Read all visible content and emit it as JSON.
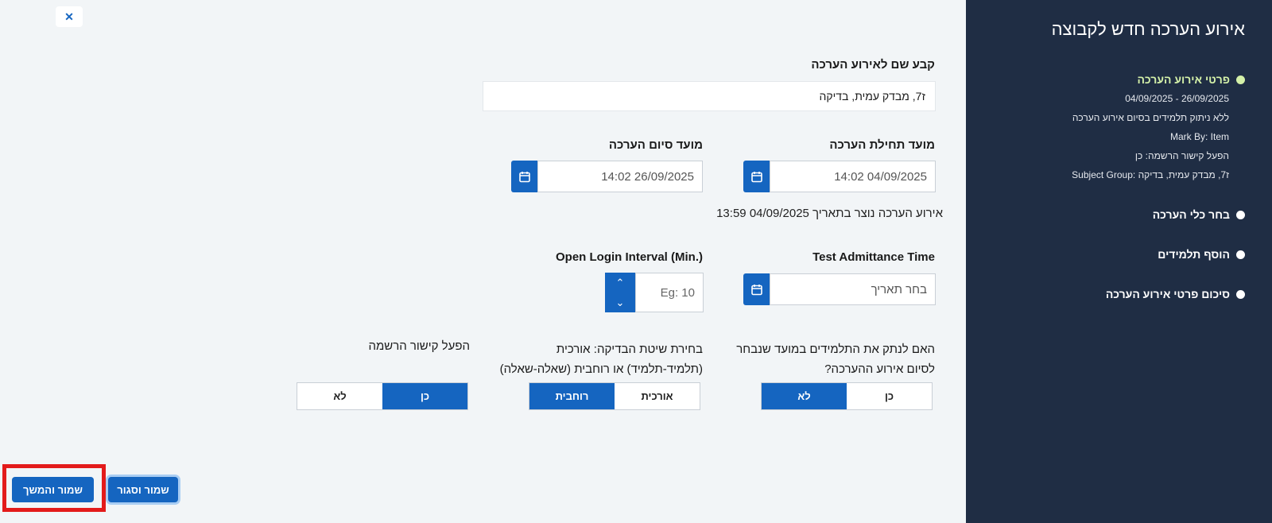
{
  "sidebar": {
    "title": "אירוע הערכה חדש לקבוצה",
    "steps": [
      {
        "label": "פרטי אירוע הערכה"
      },
      {
        "label": "בחר כלי הערכה"
      },
      {
        "label": "הוסף תלמידים"
      },
      {
        "label": "סיכום פרטי אירוע הערכה"
      }
    ],
    "details": [
      "26/09/2025 - 04/09/2025",
      "ללא ניתוק תלמידים בסיום אירוע הערכה",
      "Mark By: Item",
      "הפעל קישור הרשמה: כן",
      "Subject Group: ז7, מבדק עמית, בדיקה"
    ]
  },
  "form": {
    "name_label": "קבע שם לאירוע הערכה",
    "name_value": "ז7, מבדק עמית, בדיקה",
    "start_label": "מועד תחילת הערכה",
    "start_value": "14:02 04/09/2025",
    "end_label": "מועד סיום הערכה",
    "end_value": "14:02 26/09/2025",
    "created_note": "אירוע הערכה נוצר בתאריך 04/09/2025 13:59",
    "admittance_label": "Test Admittance Time",
    "admittance_placeholder": "בחר תאריך",
    "login_interval_label": "Open Login Interval (Min.)",
    "login_interval_placeholder": "Eg: 10",
    "disconnect_label_line1": "האם לנתק את התלמידים במועד שנבחר",
    "disconnect_label_line2": "לסיום אירוע ההערכה?",
    "disconnect_yes": "כן",
    "disconnect_no": "לא",
    "method_label_line1": "בחירת שיטת הבדיקה: אורכית",
    "method_label_line2": "(תלמיד-תלמיד) או רוחבית (שאלה-שאלה)",
    "method_vertical": "אורכית",
    "method_horizontal": "רוחבית",
    "link_label": "הפעל קישור הרשמה",
    "link_yes": "כן",
    "link_no": "לא"
  },
  "buttons": {
    "close": "✕",
    "save_continue": "שמור והמשך",
    "save_close": "שמור וסגור"
  },
  "colors": {
    "sidebar_bg": "#1f2d44",
    "accent": "#1565c0",
    "active_step": "#d4f1a9",
    "highlight": "#e31b1b"
  }
}
